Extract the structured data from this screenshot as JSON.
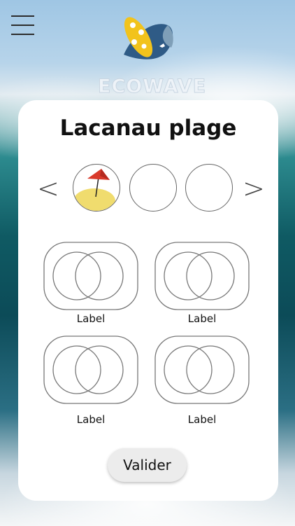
{
  "header": {
    "menu_icon": "hamburger-icon",
    "logo_text": "ECOWAVE"
  },
  "card": {
    "title": "Lacanau plage",
    "carousel": {
      "prev_label": "<",
      "next_label": ">",
      "items": [
        {
          "icon": "beach-umbrella-icon"
        },
        {
          "icon": "empty-circle"
        },
        {
          "icon": "empty-circle"
        }
      ]
    },
    "options": [
      {
        "label": "Label",
        "icon": "venn-diagram-icon"
      },
      {
        "label": "Label",
        "icon": "venn-diagram-icon"
      },
      {
        "label": "Label",
        "icon": "venn-diagram-icon"
      },
      {
        "label": "Label",
        "icon": "venn-diagram-icon"
      }
    ],
    "submit_label": "Valider"
  },
  "colors": {
    "card_bg": "#ffffff",
    "sand": "#f0dc6e",
    "umbrella": "#d93a2b",
    "button_bg": "#ececec"
  }
}
